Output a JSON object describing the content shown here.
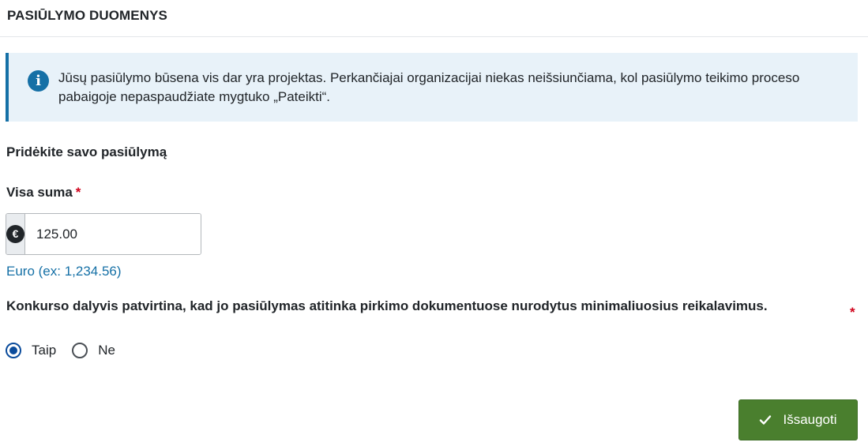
{
  "header": {
    "title": "PASIŪLYMO DUOMENYS"
  },
  "info": {
    "icon": "info-icon",
    "icon_glyph": "i",
    "text": "Jūsų pasiūlymo būsena vis dar yra projektas. Perkančiajai organizacijai niekas neišsiunčiama, kol pasiūlymo teikimo proceso pabaigoje nepaspaudžiate mygtuko „Pateikti“."
  },
  "form": {
    "section_title": "Pridėkite savo pasiūlymą",
    "amount": {
      "label": "Visa suma",
      "required_mark": "*",
      "currency_icon": "euro-icon",
      "currency_glyph": "€",
      "value": "125.00",
      "help": "Euro (ex: 1,234.56)"
    },
    "confirmation": {
      "question": "Konkurso dalyvis patvirtina, kad jo pasiūlymas atitinka pirkimo dokumentuose nurodytus minimaliuosius reikalavimus.",
      "required_mark": "*",
      "options": [
        {
          "label": "Taip",
          "checked": true
        },
        {
          "label": "Ne",
          "checked": false
        }
      ]
    }
  },
  "actions": {
    "save_label": "Išsaugoti",
    "save_icon": "check-icon"
  },
  "colors": {
    "accent_blue": "#1570a6",
    "info_bg": "#e8f2f9",
    "save_green": "#4a7f2e",
    "required_red": "#d0021b"
  }
}
